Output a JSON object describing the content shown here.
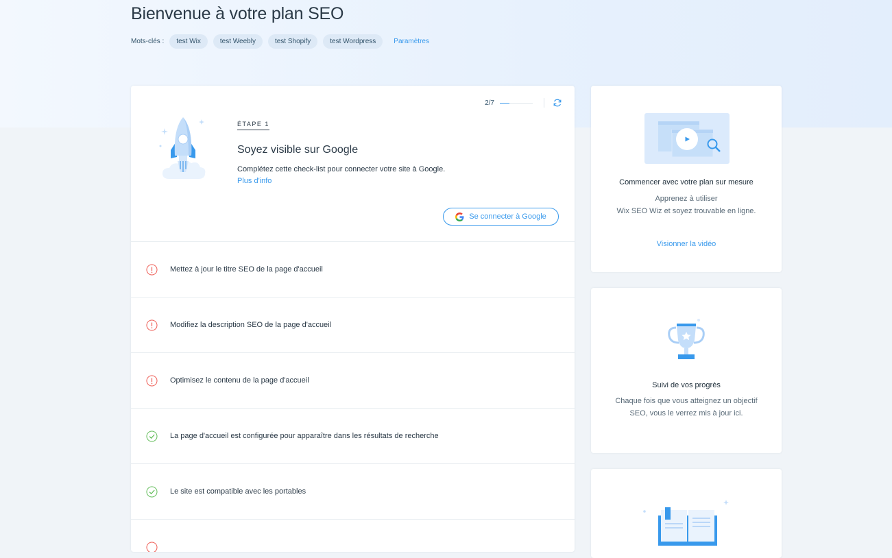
{
  "header": {
    "title": "Bienvenue à votre plan SEO",
    "keywords_label": "Mots-clés :",
    "keywords": [
      "test Wix",
      "test Weebly",
      "test Shopify",
      "test Wordpress"
    ],
    "settings_label": "Paramètres"
  },
  "main_card": {
    "progress_text": "2/7",
    "progress_fraction": 0.2857,
    "step_label": "ÉTAPE 1",
    "step_title": "Soyez visible sur Google",
    "step_desc": "Complétez cette check-list pour connecter votre site à Google.",
    "more_link": "Plus d'info",
    "google_button": "Se connecter à Google",
    "checklist": [
      {
        "text": "Mettez à jour le titre SEO de la page d'accueil",
        "status": "warning"
      },
      {
        "text": "Modifiez la description SEO de la page d'accueil",
        "status": "warning"
      },
      {
        "text": "Optimisez le contenu de la page d'accueil",
        "status": "warning"
      },
      {
        "text": "La page d'accueil est configurée pour apparaître dans les résultats de recherche",
        "status": "done"
      },
      {
        "text": "Le site est compatible avec les portables",
        "status": "done"
      }
    ]
  },
  "side_cards": {
    "video": {
      "title": "Commencer avec votre plan sur mesure",
      "desc_line1": "Apprenez à utiliser",
      "desc_line2": "Wix SEO Wiz et soyez trouvable en ligne.",
      "link": "Visionner la vidéo"
    },
    "progress": {
      "title": "Suivi de vos progrès",
      "desc_line1": "Chaque fois que vous atteignez un objectif",
      "desc_line2": "SEO, vous le verrez mis à jour ici."
    }
  },
  "colors": {
    "accent": "#3899ec",
    "warning": "#ee5951",
    "success": "#60bc57"
  }
}
